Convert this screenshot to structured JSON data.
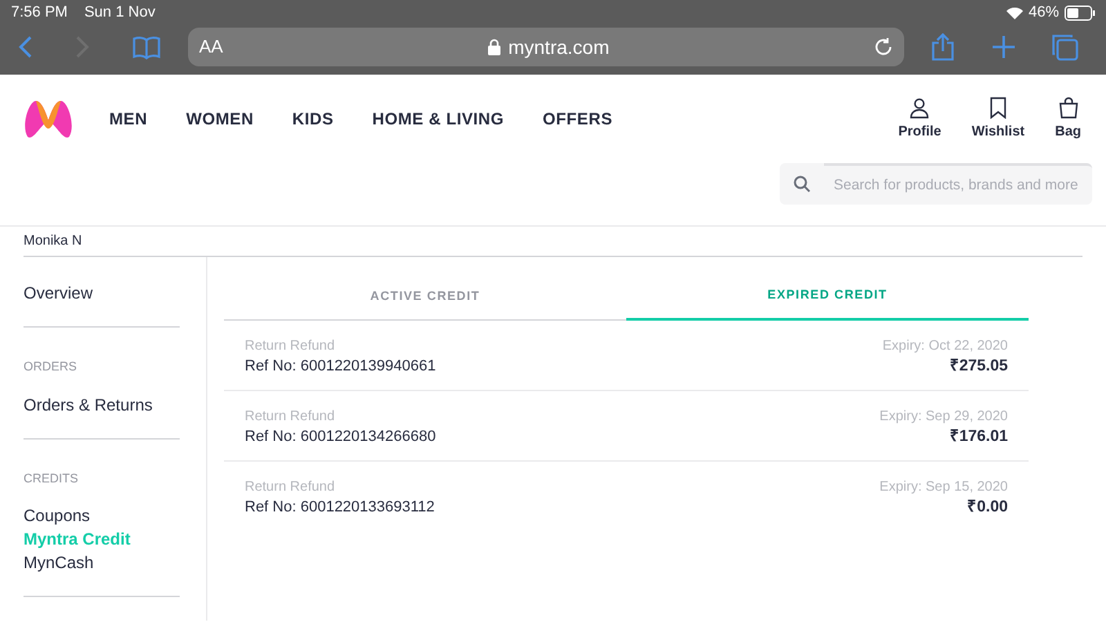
{
  "status_bar": {
    "time": "7:56 PM",
    "date": "Sun 1 Nov",
    "battery": "46%"
  },
  "browser": {
    "text_size": "AA",
    "url": "myntra.com"
  },
  "nav": [
    "MEN",
    "WOMEN",
    "KIDS",
    "HOME & LIVING",
    "OFFERS"
  ],
  "actions": [
    {
      "kind": "profile",
      "label": "Profile"
    },
    {
      "kind": "wishlist",
      "label": "Wishlist"
    },
    {
      "kind": "bag",
      "label": "Bag"
    }
  ],
  "search": {
    "placeholder": "Search for products, brands and more"
  },
  "user_name": "Monika N",
  "sidebar": [
    {
      "items": [
        {
          "label": "Overview",
          "selected": false
        }
      ]
    },
    {
      "heading": "ORDERS",
      "items": [
        {
          "label": "Orders & Returns",
          "selected": false
        }
      ]
    },
    {
      "heading": "CREDITS",
      "items": [
        {
          "label": "Coupons",
          "selected": false
        },
        {
          "label": "Myntra Credit",
          "selected": true
        },
        {
          "label": "MynCash",
          "selected": false
        }
      ]
    }
  ],
  "tabs": [
    {
      "label": "ACTIVE CREDIT",
      "selected": false
    },
    {
      "label": "EXPIRED CREDIT",
      "selected": true
    }
  ],
  "credits": [
    {
      "type": "Return Refund",
      "ref": "Ref No: 6001220139940661",
      "expiry": "Expiry: Oct 22, 2020",
      "amount": "₹275.05"
    },
    {
      "type": "Return Refund",
      "ref": "Ref No: 6001220134266680",
      "expiry": "Expiry: Sep 29, 2020",
      "amount": "₹176.01"
    },
    {
      "type": "Return Refund",
      "ref": "Ref No: 6001220133693112",
      "expiry": "Expiry: Sep 15, 2020",
      "amount": "₹0.00"
    }
  ]
}
